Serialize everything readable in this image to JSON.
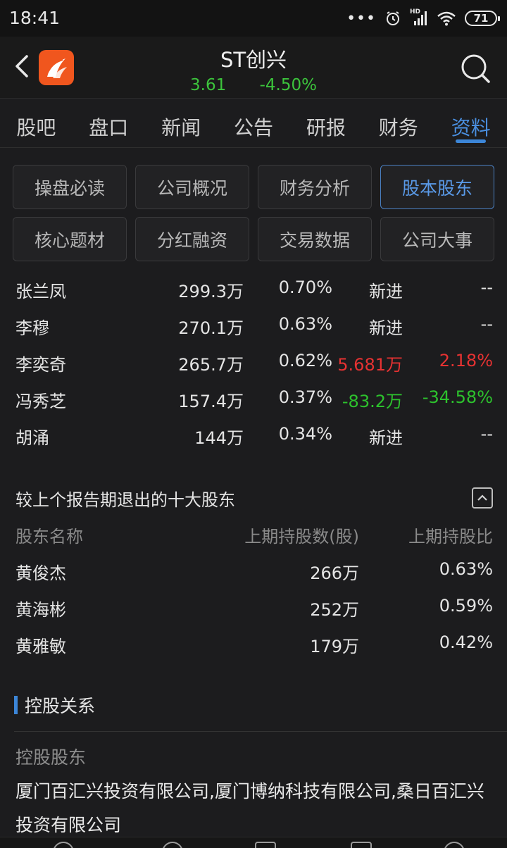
{
  "status_bar": {
    "time": "18:41",
    "more_dots": "•••",
    "network_label": "HD",
    "battery": "71"
  },
  "header": {
    "stock_name": "ST创兴",
    "price": "3.61",
    "change_pct": "-4.50%",
    "quote_color": "#3cc43c"
  },
  "tabs": [
    {
      "label": "股吧"
    },
    {
      "label": "盘口"
    },
    {
      "label": "新闻"
    },
    {
      "label": "公告"
    },
    {
      "label": "研报"
    },
    {
      "label": "财务"
    },
    {
      "label": "资料"
    }
  ],
  "active_tab": "资料",
  "chips": [
    {
      "label": "操盘必读"
    },
    {
      "label": "公司概况"
    },
    {
      "label": "财务分析"
    },
    {
      "label": "股本股东"
    },
    {
      "label": "核心题材"
    },
    {
      "label": "分红融资"
    },
    {
      "label": "交易数据"
    },
    {
      "label": "公司大事"
    }
  ],
  "active_chip": "股本股东",
  "holders": [
    {
      "name": "张兰凤",
      "shares": "299.3万",
      "ratio": "0.70%",
      "change": "新进",
      "change_pct": "--",
      "trend": "none"
    },
    {
      "name": "李穆",
      "shares": "270.1万",
      "ratio": "0.63%",
      "change": "新进",
      "change_pct": "--",
      "trend": "none"
    },
    {
      "name": "李奕奇",
      "shares": "265.7万",
      "ratio": "0.62%",
      "change": "5.681万",
      "change_pct": "2.18%",
      "trend": "up"
    },
    {
      "name": "冯秀芝",
      "shares": "157.4万",
      "ratio": "0.37%",
      "change": "-83.2万",
      "change_pct": "-34.58%",
      "trend": "down"
    },
    {
      "name": "胡涌",
      "shares": "144万",
      "ratio": "0.34%",
      "change": "新进",
      "change_pct": "--",
      "trend": "none"
    }
  ],
  "exited": {
    "title": "较上个报告期退出的十大股东",
    "columns": {
      "name": "股东名称",
      "shares": "上期持股数(股)",
      "ratio": "上期持股比"
    },
    "rows": [
      {
        "name": "黄俊杰",
        "shares": "266万",
        "ratio": "0.63%"
      },
      {
        "name": "黄海彬",
        "shares": "252万",
        "ratio": "0.59%"
      },
      {
        "name": "黄雅敏",
        "shares": "179万",
        "ratio": "0.42%"
      }
    ]
  },
  "control": {
    "title": "控股关系",
    "label": "控股股东",
    "text": "厦门百汇兴投资有限公司,厦门博纳科技有限公司,桑日百汇兴投资有限公司"
  },
  "colors": {
    "accent": "#3c86d8",
    "up": "#e63232",
    "down": "#2dc22d"
  }
}
